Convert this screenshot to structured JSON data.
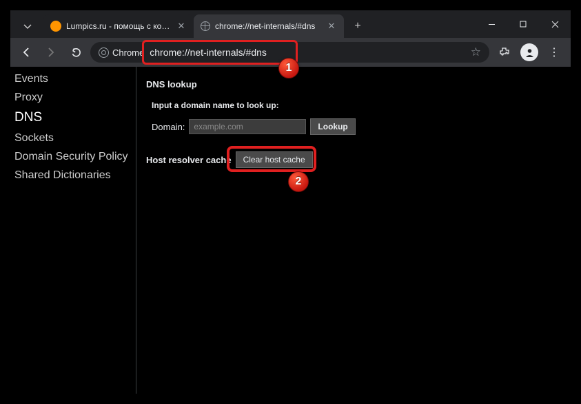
{
  "tabs": [
    {
      "title": "Lumpics.ru - помощь с компью"
    },
    {
      "title": "chrome://net-internals/#dns"
    }
  ],
  "address": {
    "chip": "Chrome",
    "url": "chrome://net-internals/#dns"
  },
  "sidebar": {
    "items": [
      {
        "label": "Events"
      },
      {
        "label": "Proxy"
      },
      {
        "label": "DNS"
      },
      {
        "label": "Sockets"
      },
      {
        "label": "Domain Security Policy"
      },
      {
        "label": "Shared Dictionaries"
      }
    ]
  },
  "main": {
    "title": "DNS lookup",
    "instruction": "Input a domain name to look up:",
    "domain_label": "Domain:",
    "domain_placeholder": "example.com",
    "lookup_label": "Lookup",
    "cache_label": "Host resolver cache",
    "clear_label": "Clear host cache"
  },
  "callouts": {
    "one": "1",
    "two": "2"
  }
}
